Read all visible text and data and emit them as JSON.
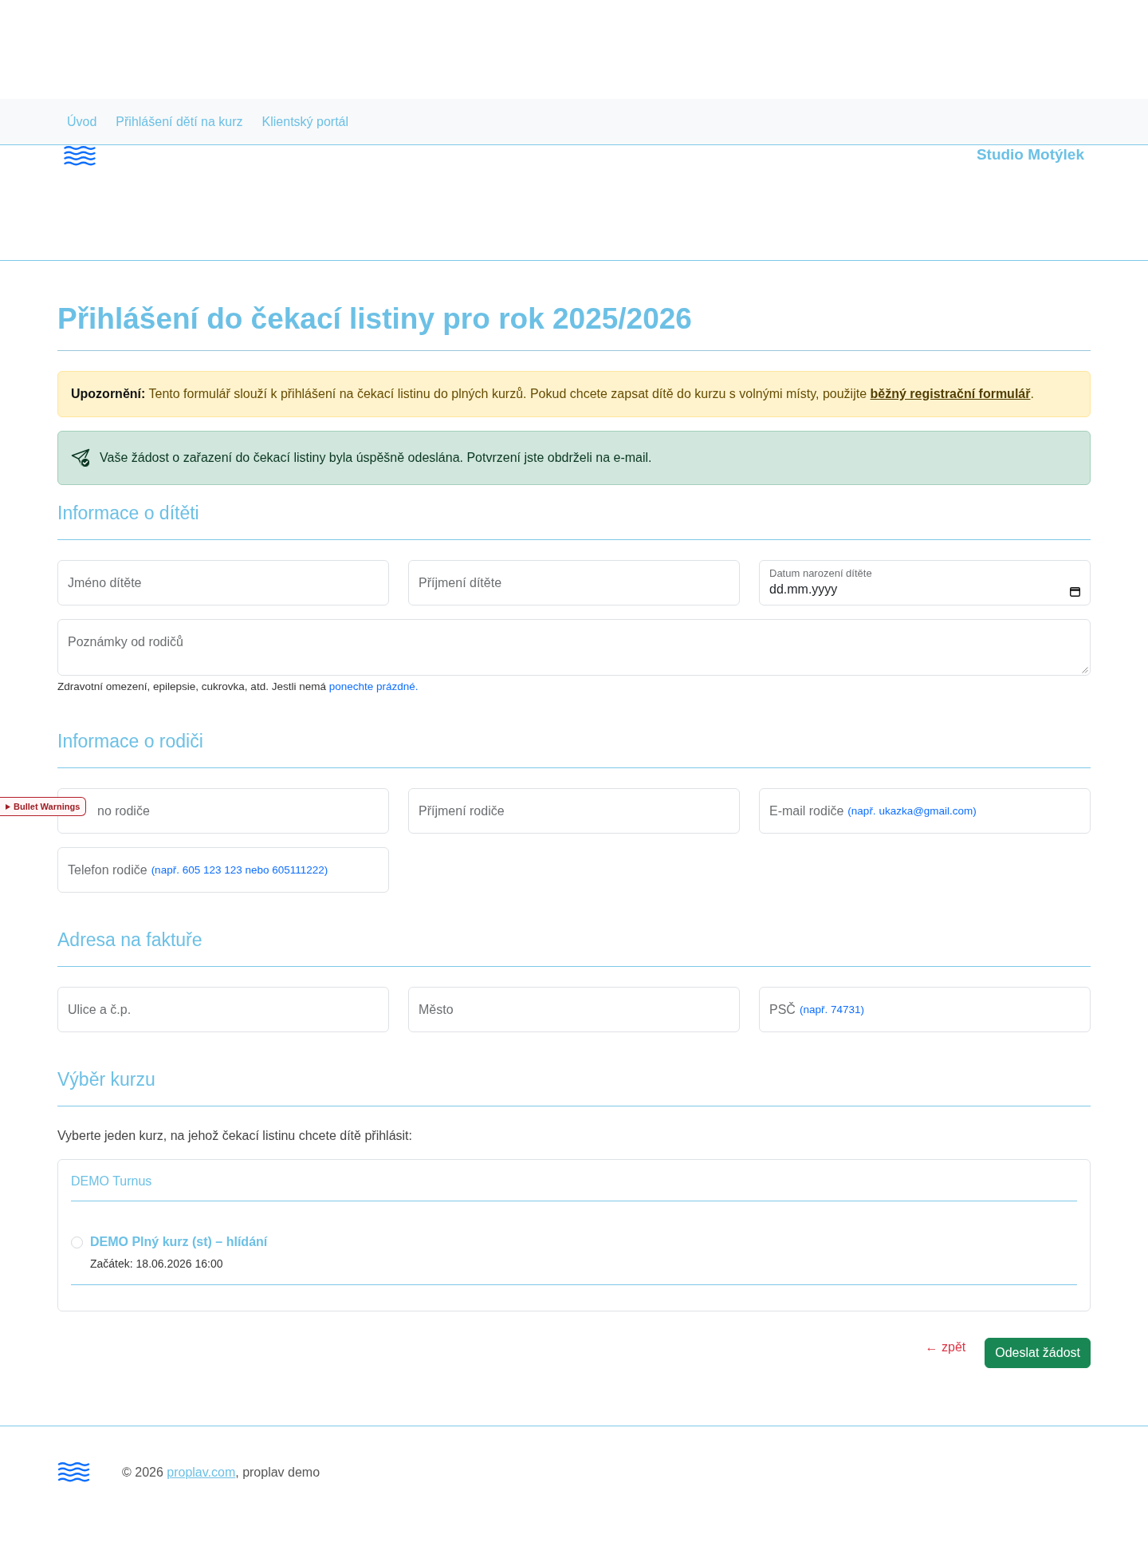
{
  "nav": {
    "links": [
      "Úvod",
      "Přihlášení dětí na kurz",
      "Klientský portál"
    ]
  },
  "header": {
    "brand": "Studio Motýlek"
  },
  "page_title": "Přihlášení do čekací listiny pro rok 2025/2026",
  "alerts": [
    {
      "kind": "warning",
      "text": "**Upozornění:** Tento formulář slouží k přihlášení na čekací listinu do plných kurzů. Pokud chcete zapsat dítě do kurzu s volnými místy, použijte",
      "link": "běžný registrační formulář",
      "text_after": "."
    },
    {
      "kind": "success",
      "text": "Vaše žádost o zařazení do čekací listiny byla úspěšně odeslána. Potvrzení jste obdrželi na e-mail."
    }
  ],
  "sections": [
    {
      "kind": "fields",
      "title": "Informace o dítěti",
      "fields": [
        {
          "kind": "text",
          "placeholder": "Jméno dítěte"
        },
        {
          "kind": "text",
          "placeholder": "Příjmení dítěte"
        },
        {
          "kind": "date",
          "label": "Datum narození dítěte",
          "placeholder": "dd.mm.yyyy"
        },
        {
          "kind": "textarea",
          "placeholder": "Poznámky od rodičů"
        }
      ],
      "help": {
        "text": "Zdravotní omezení, epilepsie, cukrovka, atd. Jestli nemá",
        "highlight": "ponechte prázdné."
      }
    },
    {
      "kind": "fields",
      "title": "Informace o rodiči",
      "fields": [
        {
          "kind": "text",
          "placeholder": "no rodiče"
        },
        {
          "kind": "text",
          "placeholder": "Příjmení rodiče"
        },
        {
          "kind": "text",
          "placeholder": "E-mail rodiče",
          "hint": "(např. ukazka@gmail.com)"
        },
        {
          "kind": "text",
          "placeholder": "Telefon rodiče",
          "hint": "(např. 605 123 123 nebo 605111222)"
        }
      ]
    },
    {
      "kind": "fields",
      "title": "Adresa na faktuře",
      "fields": [
        {
          "kind": "text",
          "placeholder": "Ulice a č.p."
        },
        {
          "kind": "text",
          "placeholder": "Město"
        },
        {
          "kind": "text",
          "placeholder": "PSČ",
          "hint": "(např. 74731)"
        }
      ]
    },
    {
      "kind": "courses",
      "title": "Výběr kurzu",
      "intro": "Vyberte jeden kurz, na jehož čekací listinu chcete dítě přihlásit:",
      "groups": [
        {
          "name": "DEMO Turnus",
          "courses": [
            {
              "title": "DEMO Plný kurz (st) – hlídání",
              "start": "Začátek: 18.06.2026 16:00",
              "selected": false
            }
          ]
        }
      ]
    }
  ],
  "actions": {
    "back": "← zpět",
    "submit": "Odeslat žádost"
  },
  "footer": {
    "text": "© 2026",
    "link": "proplav.com",
    "text_after": ", proplav demo"
  },
  "debug_badge": {
    "label": "Bullet Warnings"
  }
}
